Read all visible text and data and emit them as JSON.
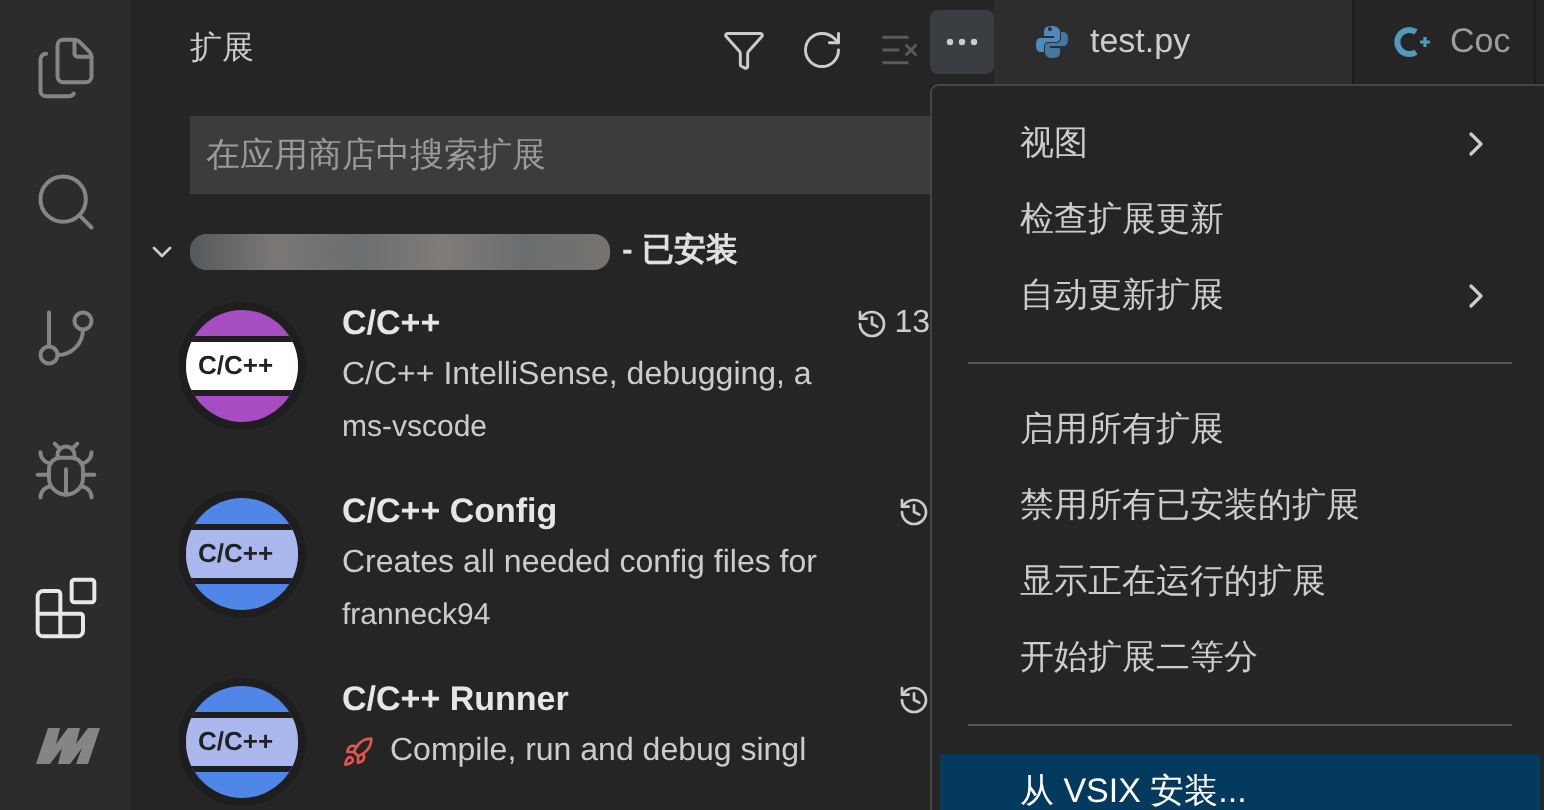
{
  "activity_bar": [
    {
      "kind": "files",
      "selected": false
    },
    {
      "kind": "search",
      "selected": false
    },
    {
      "kind": "source-control",
      "selected": false
    },
    {
      "kind": "run-debug",
      "selected": false
    },
    {
      "kind": "extensions",
      "selected": true
    },
    {
      "kind": "logo",
      "selected": false
    }
  ],
  "sidebar": {
    "title": "扩展",
    "search": {
      "placeholder": "在应用商店中搜索扩展"
    },
    "section": {
      "label": "- 已安装",
      "expanded": true
    },
    "extensions": [
      {
        "name": "C/C++",
        "description": "C/C++ IntelliSense, debugging, a",
        "publisher": "ms-vscode",
        "version": "13",
        "color": "#a64dc2",
        "badge": "C/C++"
      },
      {
        "name": "C/C++ Config",
        "description": "Creates all needed config files for",
        "publisher": "franneck94",
        "color": "#4f86e8",
        "badge": "C/C++"
      },
      {
        "name": "C/C++ Runner",
        "description": "Compile, run and debug singl",
        "rocket": true,
        "color": "#4f86e8",
        "badge": "C/C++"
      }
    ]
  },
  "tabs": [
    {
      "label": "test.py",
      "kind": "python",
      "selected": true
    },
    {
      "label": "Coc",
      "kind": "cpp",
      "selected": false
    }
  ],
  "menu": {
    "items": [
      {
        "kind": "submenu",
        "label": "视图",
        "selected": false
      },
      {
        "kind": "item",
        "label": "检查扩展更新",
        "selected": false
      },
      {
        "kind": "submenu",
        "label": "自动更新扩展",
        "selected": false
      },
      {
        "kind": "separator"
      },
      {
        "kind": "item",
        "label": "启用所有扩展",
        "selected": false
      },
      {
        "kind": "item",
        "label": "禁用所有已安装的扩展",
        "selected": false
      },
      {
        "kind": "item",
        "label": "显示正在运行的扩展",
        "selected": false
      },
      {
        "kind": "item",
        "label": "开始扩展二等分",
        "selected": false
      },
      {
        "kind": "separator"
      },
      {
        "kind": "item",
        "label": "从 VSIX 安装...",
        "selected": true
      }
    ]
  }
}
